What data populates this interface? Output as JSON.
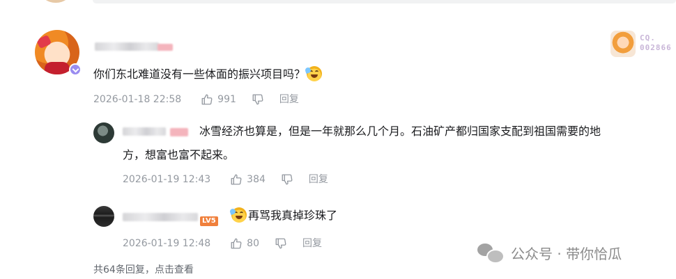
{
  "top_partial": {},
  "main_comment": {
    "fan_badge_number_top": "CQ.",
    "fan_badge_number": "002866",
    "text": "你们东北难道没有一些体面的振兴项目吗？",
    "emoji": "crying-laugh",
    "timestamp": "2026-01-18 22:58",
    "likes": "991",
    "reply_label": "回复"
  },
  "replies": [
    {
      "text_line1": "冰雪经济也算是，但是一年就那么几个月。石油矿产都归国家支配到祖国需要的地",
      "text_line2": "方，想富也富不起来。",
      "timestamp": "2026-01-19 12:43",
      "likes": "384",
      "reply_label": "回复"
    },
    {
      "level_badge": "LV5",
      "emoji": "crying-laugh",
      "text": "再骂我真掉珍珠了",
      "timestamp": "2026-01-19 12:48",
      "likes": "80",
      "reply_label": "回复"
    }
  ],
  "footer": {
    "reply_count_text": "共64条回复，",
    "view_link": "点击查看"
  },
  "watermark": {
    "text": "公众号 · 带你恰瓜"
  },
  "colors": {
    "text_primary": "#18191c",
    "text_meta": "#9499a0",
    "level_badge": "#f0803c",
    "verified_badge": "#9a8cf0"
  }
}
